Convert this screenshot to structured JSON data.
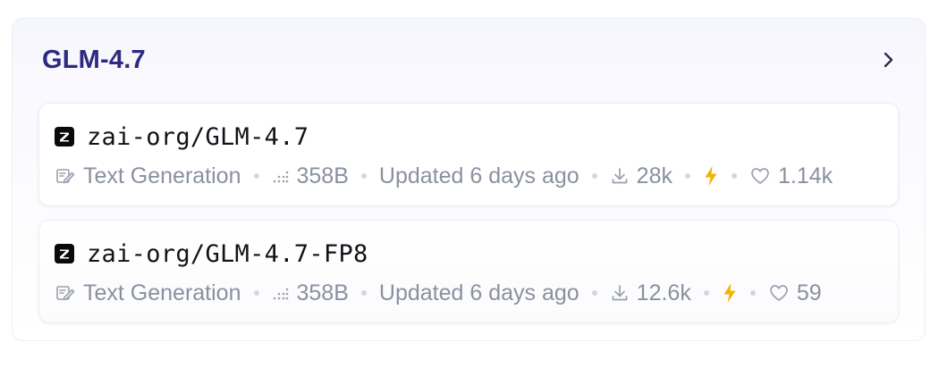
{
  "collection": {
    "title": "GLM-4.7"
  },
  "models": [
    {
      "name": "zai-org/GLM-4.7",
      "task": "Text Generation",
      "params": "358B",
      "updated": "Updated 6 days ago",
      "downloads": "28k",
      "likes": "1.14k"
    },
    {
      "name": "zai-org/GLM-4.7-FP8",
      "task": "Text Generation",
      "params": "358B",
      "updated": "Updated 6 days ago",
      "downloads": "12.6k",
      "likes": "59"
    }
  ],
  "icons": {
    "task": "text-generation-icon",
    "params": "parameters-icon",
    "downloads": "download-icon",
    "inference": "lightning-icon",
    "likes": "heart-icon",
    "expand": "chevron-right-icon",
    "org": "zai-logo-icon"
  },
  "colors": {
    "title": "#2e2a80",
    "meta_text": "#8a919f",
    "lightning": "#f5b301"
  }
}
